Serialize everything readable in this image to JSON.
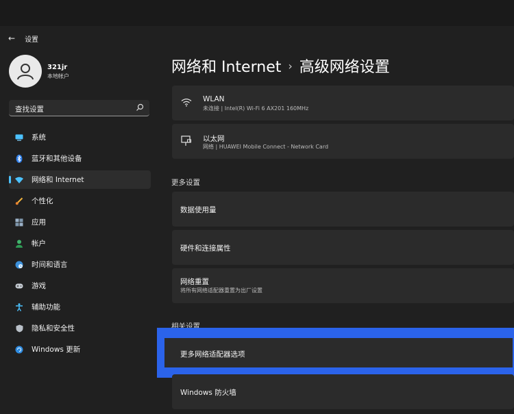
{
  "window": {
    "title": "设置"
  },
  "user": {
    "name": "321jr",
    "type": "本地帐户"
  },
  "search": {
    "placeholder": "查找设置"
  },
  "sidebar": {
    "items": [
      {
        "label": "系统",
        "icon": "monitor-icon"
      },
      {
        "label": "蓝牙和其他设备",
        "icon": "bluetooth-icon"
      },
      {
        "label": "网络和 Internet",
        "icon": "wifi-icon",
        "active": true
      },
      {
        "label": "个性化",
        "icon": "brush-icon"
      },
      {
        "label": "应用",
        "icon": "apps-icon"
      },
      {
        "label": "帐户",
        "icon": "person-icon"
      },
      {
        "label": "时间和语言",
        "icon": "globe-clock-icon"
      },
      {
        "label": "游戏",
        "icon": "gamepad-icon"
      },
      {
        "label": "辅助功能",
        "icon": "accessibility-icon"
      },
      {
        "label": "隐私和安全性",
        "icon": "shield-icon"
      },
      {
        "label": "Windows 更新",
        "icon": "sync-icon"
      }
    ]
  },
  "header": {
    "parent": "网络和 Internet",
    "separator": "›",
    "current": "高级网络设置"
  },
  "adapters": [
    {
      "name": "WLAN",
      "detail": "未连接 | Intel(R) Wi-Fi 6 AX201 160MHz",
      "icon": "wifi-icon"
    },
    {
      "name": "以太网",
      "detail": "网络 | HUAWEI Mobile Connect - Network Card",
      "icon": "ethernet-icon"
    }
  ],
  "more_settings": {
    "title": "更多设置",
    "items": [
      {
        "label": "数据使用量"
      },
      {
        "label": "硬件和连接属性"
      },
      {
        "label": "网络重置",
        "sub": "将所有网络适配器重置为出厂设置"
      }
    ]
  },
  "related_settings": {
    "title": "相关设置",
    "items": [
      {
        "label": "更多网络适配器选项",
        "highlighted": true
      },
      {
        "label": "Windows 防火墙"
      }
    ]
  },
  "colors": {
    "accent": "#4cc2ff",
    "highlight": "#2b63ea",
    "background": "#202020",
    "card": "#2b2b2b"
  }
}
